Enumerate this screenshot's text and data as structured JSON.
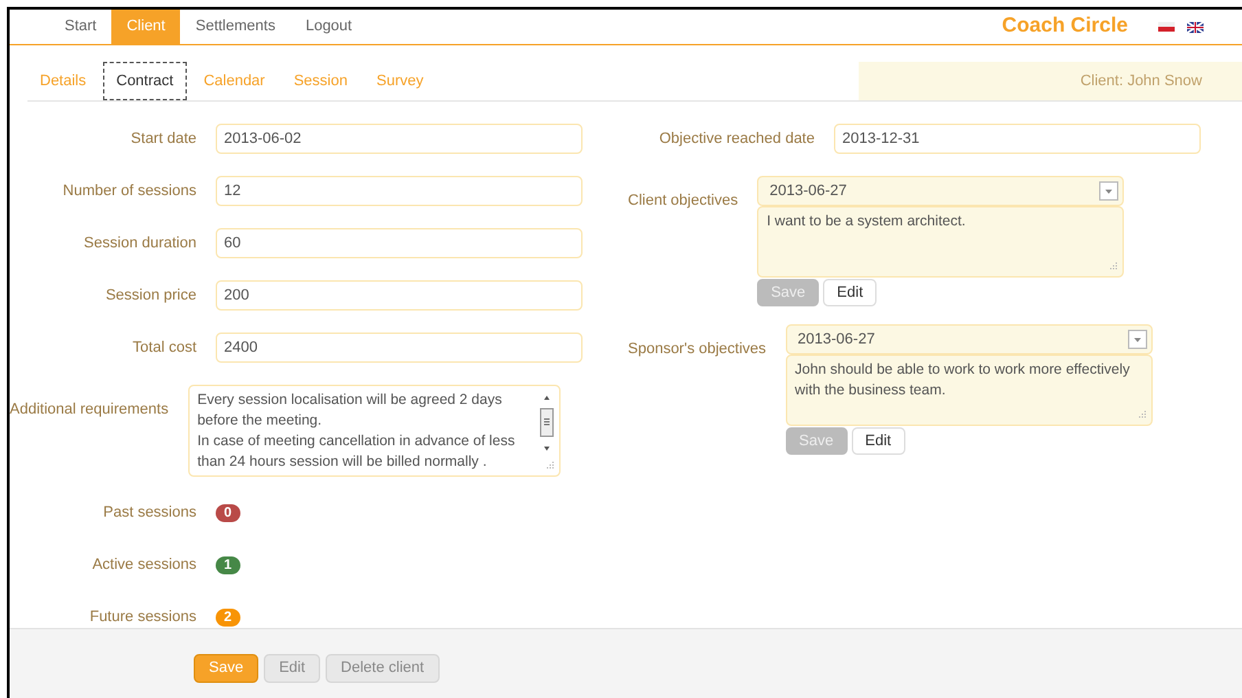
{
  "nav": {
    "items": [
      {
        "label": "Start",
        "selected": false
      },
      {
        "label": "Client",
        "selected": true
      },
      {
        "label": "Settlements",
        "selected": false
      },
      {
        "label": "Logout",
        "selected": false
      }
    ],
    "brand": "Coach Circle"
  },
  "tabs": [
    {
      "label": "Details",
      "selected": false
    },
    {
      "label": "Contract",
      "selected": true
    },
    {
      "label": "Calendar",
      "selected": false
    },
    {
      "label": "Session",
      "selected": false
    },
    {
      "label": "Survey",
      "selected": false
    }
  ],
  "client_label": "Client: John Snow",
  "left_fields": [
    {
      "label": "Start date",
      "value": "2013-06-02"
    },
    {
      "label": "Number of sessions",
      "value": "12"
    },
    {
      "label": "Session duration",
      "value": "60"
    },
    {
      "label": "Session price",
      "value": "200"
    },
    {
      "label": "Total cost",
      "value": "2400"
    }
  ],
  "additional_requirements": {
    "label": "Additional requirements",
    "value": "Every session localisation will be agreed 2 days before the meeting.\nIn case of meeting cancellation in advance of less than 24 hours session will be billed normally ."
  },
  "session_counts": [
    {
      "label": "Past sessions",
      "count": "0",
      "color": "#b94a48"
    },
    {
      "label": "Active sessions",
      "count": "1",
      "color": "#468847"
    },
    {
      "label": "Future sessions",
      "count": "2",
      "color": "#f89406"
    }
  ],
  "objective_reached": {
    "label": "Objective reached date",
    "value": "2013-12-31"
  },
  "objectives": [
    {
      "label": "Client objectives",
      "date": "2013-06-27",
      "text": "I want to be a system architect.",
      "buttons": [
        {
          "label": "Save",
          "disabled": true
        },
        {
          "label": "Edit",
          "disabled": false
        }
      ]
    },
    {
      "label": "Sponsor's objectives",
      "date": "2013-06-27",
      "text": "John should be able to work to work more effectively with the business team.",
      "buttons": [
        {
          "label": "Save",
          "disabled": true
        },
        {
          "label": "Edit",
          "disabled": false
        }
      ]
    }
  ],
  "footer_buttons": [
    {
      "label": "Save",
      "kind": "primary"
    },
    {
      "label": "Edit",
      "kind": "default"
    },
    {
      "label": "Delete client",
      "kind": "default"
    }
  ]
}
